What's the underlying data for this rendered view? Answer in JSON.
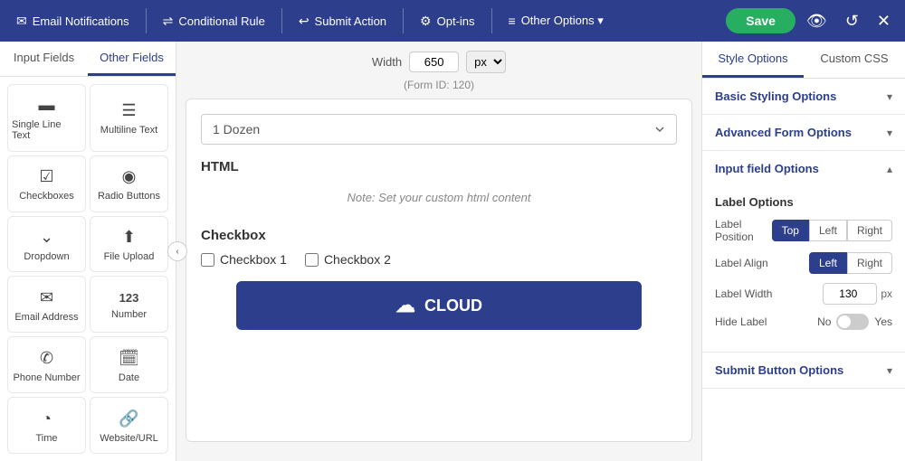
{
  "nav": {
    "items": [
      {
        "id": "email-notifications",
        "icon": "✉",
        "label": "Email Notifications"
      },
      {
        "id": "conditional-rule",
        "icon": "⇌",
        "label": "Conditional Rule"
      },
      {
        "id": "submit-action",
        "icon": "↩",
        "label": "Submit Action"
      },
      {
        "id": "opt-ins",
        "icon": "⚙",
        "label": "Opt-ins"
      },
      {
        "id": "other-options",
        "icon": "≡",
        "label": "Other Options ▾"
      }
    ],
    "save_label": "Save"
  },
  "left_panel": {
    "tabs": [
      "Input Fields",
      "Other Fields"
    ],
    "active_tab": "Other Fields",
    "fields": [
      {
        "id": "single-line-text",
        "icon": "▬",
        "label": "Single Line Text"
      },
      {
        "id": "multiline-text",
        "icon": "☰",
        "label": "Multiline Text"
      },
      {
        "id": "checkboxes",
        "icon": "☑",
        "label": "Checkboxes"
      },
      {
        "id": "radio-buttons",
        "icon": "◉",
        "label": "Radio Buttons"
      },
      {
        "id": "dropdown",
        "icon": "⌄",
        "label": "Dropdown"
      },
      {
        "id": "file-upload",
        "icon": "⬆",
        "label": "File Upload"
      },
      {
        "id": "email-address",
        "icon": "✉",
        "label": "Email Address"
      },
      {
        "id": "number",
        "icon": "123",
        "label": "Number"
      },
      {
        "id": "phone-number",
        "icon": "✆",
        "label": "Phone Number"
      },
      {
        "id": "date",
        "icon": "🗓",
        "label": "Date"
      },
      {
        "id": "time",
        "icon": "◔",
        "label": "Time"
      },
      {
        "id": "website-url",
        "icon": "🔗",
        "label": "Website/URL"
      }
    ]
  },
  "canvas": {
    "width_label": "Width",
    "width_value": "650",
    "width_unit": "px",
    "form_id_text": "(Form ID: 120)",
    "dropdown_value": "1 Dozen",
    "html_section_title": "HTML",
    "html_note": "Note: Set your custom html content",
    "checkbox_section_title": "Checkbox",
    "checkbox_options": [
      "Checkbox 1",
      "Checkbox 2"
    ],
    "submit_button_label": "CLOUD"
  },
  "right_panel": {
    "tabs": [
      "Style Options",
      "Custom CSS"
    ],
    "active_tab": "Style Options",
    "accordion": [
      {
        "id": "basic-styling",
        "title": "Basic Styling Options",
        "expanded": false,
        "chevron": "▾"
      },
      {
        "id": "advanced-form",
        "title": "Advanced Form Options",
        "expanded": false,
        "chevron": "▾"
      },
      {
        "id": "input-field",
        "title": "Input field Options",
        "expanded": true,
        "chevron": "▴"
      }
    ],
    "input_field_options": {
      "section_title": "Label Options",
      "label_position": {
        "label": "Label Position",
        "options": [
          "Top",
          "Left",
          "Right"
        ],
        "active": "Top"
      },
      "label_align": {
        "label": "Label Align",
        "options": [
          "Left",
          "Right"
        ],
        "active": "Left"
      },
      "label_width": {
        "label": "Label Width",
        "value": "130",
        "unit": "px"
      },
      "hide_label": {
        "label": "Hide Label",
        "no": "No",
        "yes": "Yes",
        "checked": false
      }
    },
    "submit_button_options": {
      "title": "Submit Button Options",
      "expanded": false,
      "chevron": "▾"
    }
  }
}
